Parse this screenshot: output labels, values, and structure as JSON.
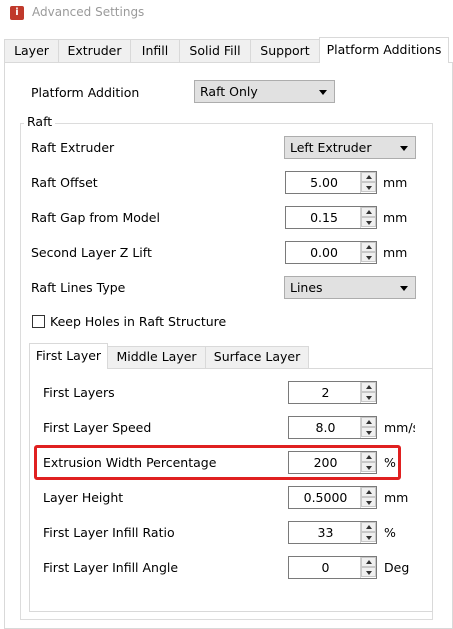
{
  "window": {
    "title": "Advanced Settings",
    "icon": "app-logo-icon"
  },
  "tabs": [
    {
      "label": "Layer"
    },
    {
      "label": "Extruder"
    },
    {
      "label": "Infill"
    },
    {
      "label": "Solid Fill"
    },
    {
      "label": "Support"
    },
    {
      "label": "Platform Additions",
      "active": true
    }
  ],
  "platform_addition": {
    "label": "Platform Addition",
    "value": "Raft Only"
  },
  "raft": {
    "group_title": "Raft",
    "extruder": {
      "label": "Raft Extruder",
      "value": "Left Extruder"
    },
    "offset": {
      "label": "Raft Offset",
      "value": "5.00",
      "unit": "mm"
    },
    "gap": {
      "label": "Raft Gap from Model",
      "value": "0.15",
      "unit": "mm"
    },
    "second_layer_lift": {
      "label": "Second Layer Z Lift",
      "value": "0.00",
      "unit": "mm"
    },
    "lines_type": {
      "label": "Raft Lines Type",
      "value": "Lines"
    },
    "keep_holes": {
      "label": "Keep Holes in Raft Structure",
      "checked": false
    }
  },
  "subtabs": [
    {
      "label": "First Layer",
      "active": true
    },
    {
      "label": "Middle Layer"
    },
    {
      "label": "Surface Layer"
    }
  ],
  "first_layer": {
    "layers": {
      "label": "First Layers",
      "value": "2"
    },
    "speed": {
      "label": "First Layer Speed",
      "value": "8.0",
      "unit": "mm/s"
    },
    "extrusion_width": {
      "label": "Extrusion Width Percentage",
      "value": "200",
      "unit": "%",
      "highlighted": true
    },
    "layer_height": {
      "label": "Layer Height",
      "value": "0.5000",
      "unit": "mm"
    },
    "infill_ratio": {
      "label": "First Layer Infill Ratio",
      "value": "33",
      "unit": "%"
    },
    "infill_angle": {
      "label": "First Layer Infill Angle",
      "value": "0",
      "unit": "Deg"
    }
  },
  "colors": {
    "highlight": "#e02020"
  }
}
